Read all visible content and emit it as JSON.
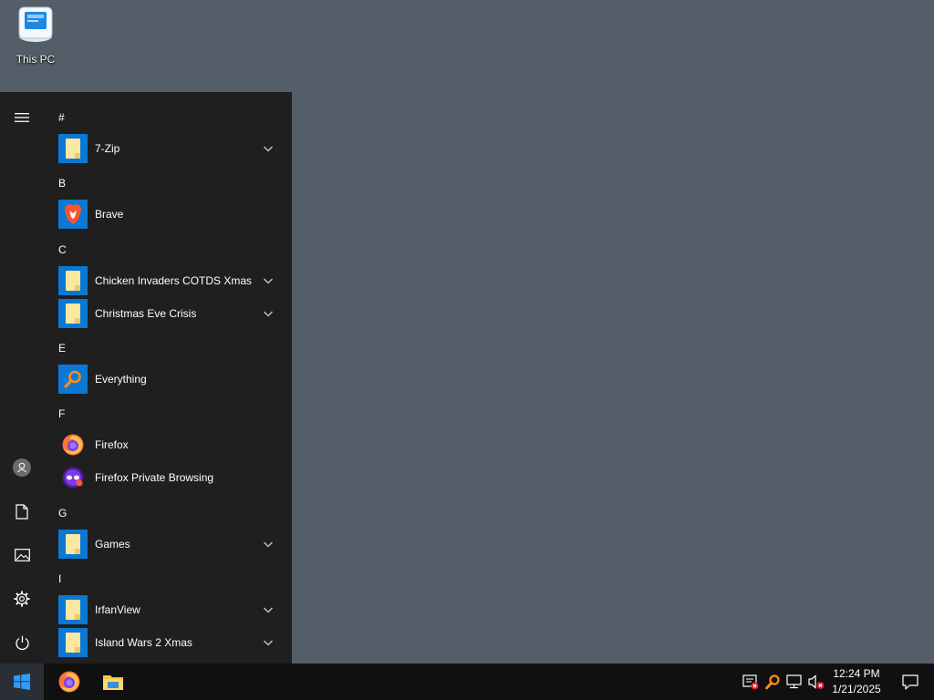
{
  "desktop": {
    "icons": [
      {
        "label": "This PC",
        "icon": "this-pc-icon"
      }
    ]
  },
  "start_menu": {
    "rail": [
      {
        "name": "hamburger-menu",
        "icon": "menu-icon"
      },
      {
        "name": "account",
        "icon": "user-avatar-icon"
      },
      {
        "name": "documents",
        "icon": "document-icon"
      },
      {
        "name": "pictures",
        "icon": "pictures-icon"
      },
      {
        "name": "settings",
        "icon": "gear-icon"
      },
      {
        "name": "power",
        "icon": "power-icon"
      }
    ],
    "sections": [
      {
        "letter": "#",
        "apps": [
          {
            "label": "7-Zip",
            "icon": "folder-icon",
            "expandable": true
          }
        ]
      },
      {
        "letter": "B",
        "apps": [
          {
            "label": "Brave",
            "icon": "brave-icon",
            "expandable": false
          }
        ]
      },
      {
        "letter": "C",
        "apps": [
          {
            "label": "Chicken Invaders COTDS Xmas",
            "icon": "folder-icon",
            "expandable": true
          },
          {
            "label": "Christmas Eve Crisis",
            "icon": "folder-icon",
            "expandable": true
          }
        ]
      },
      {
        "letter": "E",
        "apps": [
          {
            "label": "Everything",
            "icon": "everything-search-icon",
            "expandable": false
          }
        ]
      },
      {
        "letter": "F",
        "apps": [
          {
            "label": "Firefox",
            "icon": "firefox-icon",
            "expandable": false
          },
          {
            "label": "Firefox Private Browsing",
            "icon": "firefox-private-icon",
            "expandable": false
          }
        ]
      },
      {
        "letter": "G",
        "apps": [
          {
            "label": "Games",
            "icon": "folder-icon",
            "expandable": true
          }
        ]
      },
      {
        "letter": "I",
        "apps": [
          {
            "label": "IrfanView",
            "icon": "folder-icon",
            "expandable": true
          },
          {
            "label": "Island Wars 2 Xmas",
            "icon": "folder-icon",
            "expandable": true
          }
        ]
      }
    ]
  },
  "taskbar": {
    "pinned": [
      {
        "name": "start",
        "icon": "windows-logo-icon"
      },
      {
        "name": "firefox",
        "icon": "firefox-icon"
      },
      {
        "name": "file-explorer",
        "icon": "file-explorer-icon"
      }
    ],
    "tray": [
      {
        "name": "security-alert",
        "icon": "security-alert-icon"
      },
      {
        "name": "everything",
        "icon": "everything-search-icon"
      },
      {
        "name": "network",
        "icon": "network-icon"
      },
      {
        "name": "volume-muted",
        "icon": "volume-muted-icon"
      }
    ],
    "clock": {
      "time": "12:24 PM",
      "date": "1/21/2025"
    },
    "notifications_icon": "notification-center-icon"
  },
  "colors": {
    "desktop_bg": "#545e69",
    "start_menu_bg": "#1f1f1f",
    "taskbar_bg": "#101010",
    "tile_blue": "#0a78d4",
    "folder_yellow": "#fbe7a0"
  }
}
